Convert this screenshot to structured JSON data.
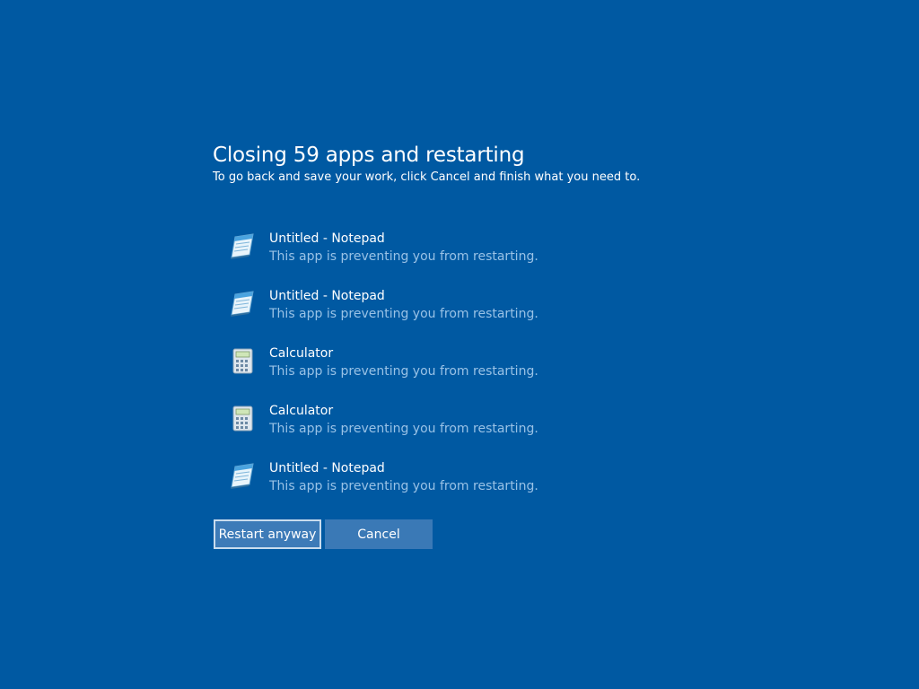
{
  "dialog": {
    "title": "Closing 59 apps and restarting",
    "subtitle": "To go back and save your work, click Cancel and finish what you need to."
  },
  "apps": [
    {
      "name": "Untitled - Notepad",
      "status": "This app is preventing you from restarting.",
      "icon": "notepad-icon"
    },
    {
      "name": "Untitled - Notepad",
      "status": "This app is preventing you from restarting.",
      "icon": "notepad-icon"
    },
    {
      "name": "Calculator",
      "status": "This app is preventing you from restarting.",
      "icon": "calculator-icon"
    },
    {
      "name": "Calculator",
      "status": "This app is preventing you from restarting.",
      "icon": "calculator-icon"
    },
    {
      "name": "Untitled - Notepad",
      "status": "This app is preventing you from restarting.",
      "icon": "notepad-icon"
    }
  ],
  "buttons": {
    "restart_label": "Restart anyway",
    "cancel_label": "Cancel"
  },
  "colors": {
    "background": "#0059a2",
    "status_text": "#99c2e6",
    "button": "#3a79b6"
  }
}
